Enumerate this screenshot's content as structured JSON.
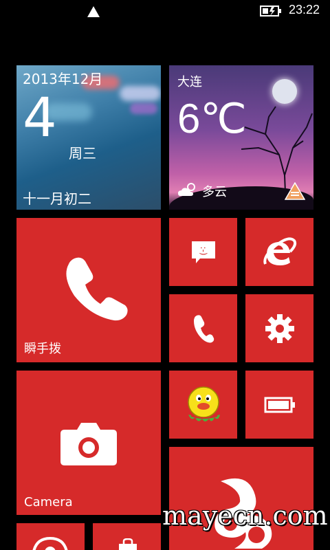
{
  "status_bar": {
    "time": "23:22"
  },
  "calendar": {
    "year_month": "2013年12月",
    "day": "4",
    "weekday": "周三",
    "lunar": "十一月初二"
  },
  "weather": {
    "city": "大连",
    "temperature": "6℃",
    "condition": "多云"
  },
  "tiles": {
    "speed_dial": "瞬手拨",
    "camera": "Camera"
  },
  "watermark": "mayecn.com",
  "colors": {
    "tile_accent": "#d62a2a",
    "background": "#000000"
  }
}
